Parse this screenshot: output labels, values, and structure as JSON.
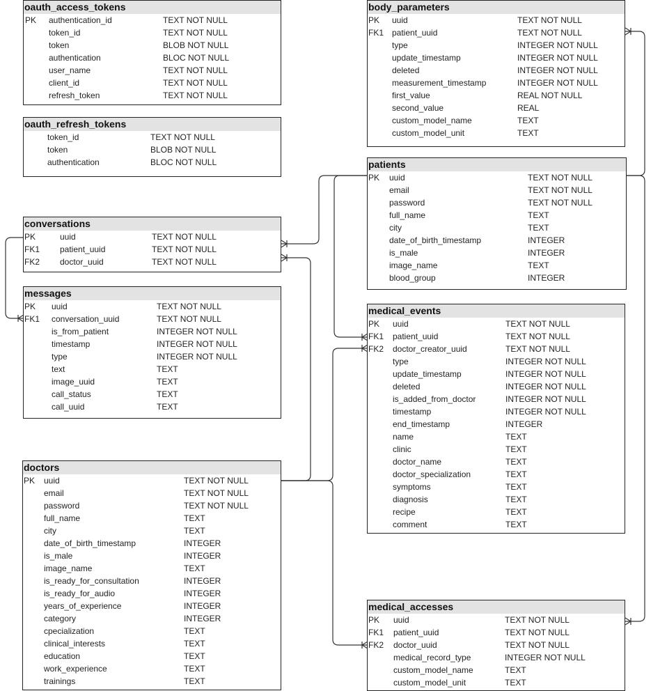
{
  "diagram_title": "",
  "tables": {
    "oauth_access_tokens": {
      "name": "oauth_access_tokens",
      "columns": [
        {
          "key": "PK",
          "name": "authentication_id",
          "type": "TEXT NOT NULL"
        },
        {
          "key": "",
          "name": "token_id",
          "type": "TEXT NOT NULL"
        },
        {
          "key": "",
          "name": "token",
          "type": "BLOB NOT NULL"
        },
        {
          "key": "",
          "name": "authentication",
          "type": "BLOC NOT NULL"
        },
        {
          "key": "",
          "name": "user_name",
          "type": "TEXT NOT NULL"
        },
        {
          "key": "",
          "name": "client_id",
          "type": "TEXT NOT NULL"
        },
        {
          "key": "",
          "name": "refresh_token",
          "type": "TEXT NOT NULL"
        }
      ]
    },
    "oauth_refresh_tokens": {
      "name": "oauth_refresh_tokens",
      "columns": [
        {
          "key": "",
          "name": "token_id",
          "type": "TEXT NOT NULL"
        },
        {
          "key": "",
          "name": "token",
          "type": "BLOB NOT NULL"
        },
        {
          "key": "",
          "name": "authentication",
          "type": "BLOC NOT NULL"
        }
      ]
    },
    "conversations": {
      "name": "conversations",
      "columns": [
        {
          "key": "PK",
          "name": "uuid",
          "type": "TEXT NOT NULL"
        },
        {
          "key": "FK1",
          "name": "patient_uuid",
          "type": "TEXT NOT NULL"
        },
        {
          "key": "FK2",
          "name": "doctor_uuid",
          "type": "TEXT NOT NULL"
        }
      ]
    },
    "messages": {
      "name": "messages",
      "columns": [
        {
          "key": "PK",
          "name": "uuid",
          "type": "TEXT NOT NULL"
        },
        {
          "key": "FK1",
          "name": "conversation_uuid",
          "type": "TEXT NOT NULL"
        },
        {
          "key": "",
          "name": "is_from_patient",
          "type": "INTEGER NOT NULL"
        },
        {
          "key": "",
          "name": "timestamp",
          "type": "INTEGER NOT NULL"
        },
        {
          "key": "",
          "name": "type",
          "type": "INTEGER NOT NULL"
        },
        {
          "key": "",
          "name": "text",
          "type": "TEXT"
        },
        {
          "key": "",
          "name": "image_uuid",
          "type": "TEXT"
        },
        {
          "key": "",
          "name": "call_status",
          "type": "TEXT"
        },
        {
          "key": "",
          "name": "call_uuid",
          "type": "TEXT"
        }
      ]
    },
    "doctors": {
      "name": "doctors",
      "columns": [
        {
          "key": "PK",
          "name": "uuid",
          "type": "TEXT NOT NULL"
        },
        {
          "key": "",
          "name": "email",
          "type": "TEXT NOT NULL"
        },
        {
          "key": "",
          "name": "password",
          "type": "TEXT NOT NULL"
        },
        {
          "key": "",
          "name": "full_name",
          "type": "TEXT"
        },
        {
          "key": "",
          "name": "city",
          "type": "TEXT"
        },
        {
          "key": "",
          "name": "date_of_birth_timestamp",
          "type": "INTEGER"
        },
        {
          "key": "",
          "name": "is_male",
          "type": "INTEGER"
        },
        {
          "key": "",
          "name": "image_name",
          "type": "TEXT"
        },
        {
          "key": "",
          "name": "is_ready_for_consultation",
          "type": "INTEGER"
        },
        {
          "key": "",
          "name": "is_ready_for_audio",
          "type": "INTEGER"
        },
        {
          "key": "",
          "name": "years_of_experience",
          "type": "INTEGER"
        },
        {
          "key": "",
          "name": "category",
          "type": "INTEGER"
        },
        {
          "key": "",
          "name": "cpecialization",
          "type": "TEXT"
        },
        {
          "key": "",
          "name": "clinical_interests",
          "type": "TEXT"
        },
        {
          "key": "",
          "name": "education",
          "type": "TEXT"
        },
        {
          "key": "",
          "name": "work_experience",
          "type": "TEXT"
        },
        {
          "key": "",
          "name": "trainings",
          "type": "TEXT"
        }
      ]
    },
    "body_parameters": {
      "name": "body_parameters",
      "columns": [
        {
          "key": "PK",
          "name": "uuid",
          "type": "TEXT NOT NULL"
        },
        {
          "key": "FK1",
          "name": "patient_uuid",
          "type": "TEXT NOT NULL"
        },
        {
          "key": "",
          "name": "type",
          "type": "INTEGER NOT NULL"
        },
        {
          "key": "",
          "name": "update_timestamp",
          "type": "INTEGER NOT NULL"
        },
        {
          "key": "",
          "name": "deleted",
          "type": "INTEGER NOT NULL"
        },
        {
          "key": "",
          "name": "measurement_timestamp",
          "type": "INTEGER NOT NULL"
        },
        {
          "key": "",
          "name": "first_value",
          "type": "REAL NOT NULL"
        },
        {
          "key": "",
          "name": "second_value",
          "type": "REAL"
        },
        {
          "key": "",
          "name": "custom_model_name",
          "type": "TEXT"
        },
        {
          "key": "",
          "name": "custom_model_unit",
          "type": "TEXT"
        }
      ]
    },
    "patients": {
      "name": "patients",
      "columns": [
        {
          "key": "PK",
          "name": "uuid",
          "type": "TEXT NOT NULL"
        },
        {
          "key": "",
          "name": "email",
          "type": "TEXT NOT NULL"
        },
        {
          "key": "",
          "name": "password",
          "type": "TEXT NOT NULL"
        },
        {
          "key": "",
          "name": "full_name",
          "type": "TEXT"
        },
        {
          "key": "",
          "name": "city",
          "type": "TEXT"
        },
        {
          "key": "",
          "name": "date_of_birth_timestamp",
          "type": "INTEGER"
        },
        {
          "key": "",
          "name": "is_male",
          "type": "INTEGER"
        },
        {
          "key": "",
          "name": "image_name",
          "type": "TEXT"
        },
        {
          "key": "",
          "name": "blood_group",
          "type": "INTEGER"
        }
      ]
    },
    "medical_events": {
      "name": "medical_events",
      "columns": [
        {
          "key": "PK",
          "name": "uuid",
          "type": "TEXT NOT NULL"
        },
        {
          "key": "FK1",
          "name": "patient_uuid",
          "type": "TEXT NOT NULL"
        },
        {
          "key": "FK2",
          "name": "doctor_creator_uuid",
          "type": "TEXT NOT NULL"
        },
        {
          "key": "",
          "name": "type",
          "type": "INTEGER NOT NULL"
        },
        {
          "key": "",
          "name": "update_timestamp",
          "type": "INTEGER NOT NULL"
        },
        {
          "key": "",
          "name": "deleted",
          "type": "INTEGER NOT NULL"
        },
        {
          "key": "",
          "name": "is_added_from_doctor",
          "type": "INTEGER NOT NULL"
        },
        {
          "key": "",
          "name": "timestamp",
          "type": "INTEGER NOT NULL"
        },
        {
          "key": "",
          "name": "end_timestamp",
          "type": "INTEGER"
        },
        {
          "key": "",
          "name": "name",
          "type": "TEXT"
        },
        {
          "key": "",
          "name": "clinic",
          "type": "TEXT"
        },
        {
          "key": "",
          "name": "doctor_name",
          "type": "TEXT"
        },
        {
          "key": "",
          "name": "doctor_specialization",
          "type": "TEXT"
        },
        {
          "key": "",
          "name": "symptoms",
          "type": "TEXT"
        },
        {
          "key": "",
          "name": "diagnosis",
          "type": "TEXT"
        },
        {
          "key": "",
          "name": "recipe",
          "type": "TEXT"
        },
        {
          "key": "",
          "name": "comment",
          "type": "TEXT"
        }
      ]
    },
    "medical_accesses": {
      "name": "medical_accesses",
      "columns": [
        {
          "key": "PK",
          "name": "uuid",
          "type": "TEXT NOT NULL"
        },
        {
          "key": "FK1",
          "name": "patient_uuid",
          "type": "TEXT NOT NULL"
        },
        {
          "key": "FK2",
          "name": "doctor_uuid",
          "type": "TEXT NOT NULL"
        },
        {
          "key": "",
          "name": "medical_record_type",
          "type": "INTEGER NOT NULL"
        },
        {
          "key": "",
          "name": "custom_model_name",
          "type": "TEXT"
        },
        {
          "key": "",
          "name": "custom_model_unit",
          "type": "TEXT"
        }
      ]
    }
  },
  "relationships": [
    {
      "from": "conversations.uuid",
      "to": "messages.conversation_uuid",
      "cardinality": "one-to-many"
    },
    {
      "from": "patients.uuid",
      "to": "conversations.patient_uuid",
      "cardinality": "one-to-many"
    },
    {
      "from": "doctors.uuid",
      "to": "conversations.doctor_uuid",
      "cardinality": "one-to-many"
    },
    {
      "from": "patients.uuid",
      "to": "body_parameters.patient_uuid",
      "cardinality": "one-to-many"
    },
    {
      "from": "patients.uuid",
      "to": "medical_events.patient_uuid",
      "cardinality": "one-to-many"
    },
    {
      "from": "doctors.uuid",
      "to": "medical_events.doctor_creator_uuid",
      "cardinality": "one-to-many"
    },
    {
      "from": "patients.uuid",
      "to": "medical_accesses.patient_uuid",
      "cardinality": "one-to-many"
    },
    {
      "from": "doctors.uuid",
      "to": "medical_accesses.doctor_uuid",
      "cardinality": "one-to-many"
    }
  ]
}
